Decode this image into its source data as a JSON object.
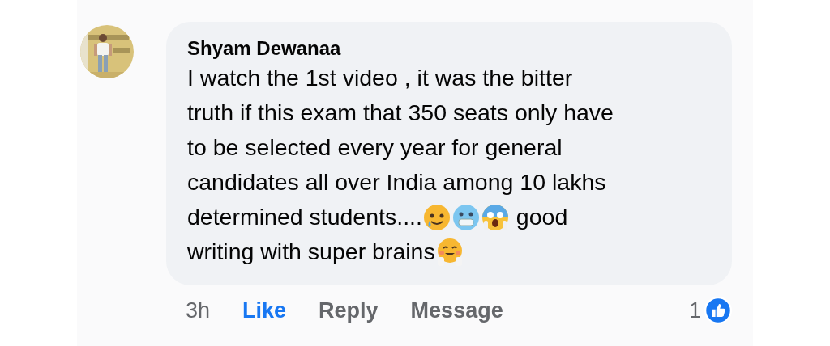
{
  "comment": {
    "author": "Shyam Dewanaa",
    "lines": [
      [
        {
          "kind": "text",
          "text": "I watch the 1st video , it was the bitter"
        }
      ],
      [
        {
          "kind": "text",
          "text": "truth if this exam that 350 seats only have"
        }
      ],
      [
        {
          "kind": "text",
          "text": "to be selected every year for general"
        }
      ],
      [
        {
          "kind": "text",
          "text": "candidates all over India among 10 lakhs"
        }
      ],
      [
        {
          "kind": "text",
          "text": "determined students...."
        },
        {
          "kind": "smile-tear"
        },
        {
          "kind": "cold-face"
        },
        {
          "kind": "scream"
        },
        {
          "kind": "text",
          "text": " good"
        }
      ],
      [
        {
          "kind": "text",
          "text": "writing with super brains"
        },
        {
          "kind": "hug"
        }
      ]
    ],
    "time": "3h",
    "actions": [
      {
        "label": "Like",
        "selected": true
      },
      {
        "label": "Reply",
        "selected": false
      },
      {
        "label": "Message",
        "selected": false
      }
    ],
    "reaction_count": "1"
  }
}
